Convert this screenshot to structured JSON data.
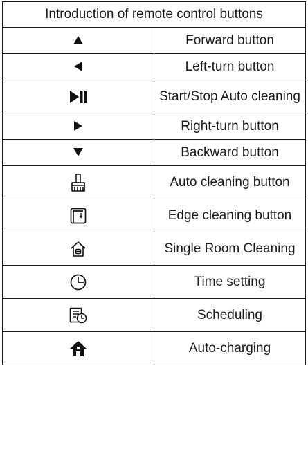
{
  "table": {
    "title": "Introduction of remote control buttons",
    "rows": [
      {
        "icon": "up-triangle-icon",
        "label": "Forward button"
      },
      {
        "icon": "left-triangle-icon",
        "label": "Left-turn button"
      },
      {
        "icon": "play-pause-icon",
        "label": "Start/Stop Auto cleaning"
      },
      {
        "icon": "right-triangle-icon",
        "label": "Right-turn button"
      },
      {
        "icon": "down-triangle-icon",
        "label": "Backward button"
      },
      {
        "icon": "brush-icon",
        "label": "Auto cleaning button"
      },
      {
        "icon": "edge-corner-icon",
        "label": "Edge cleaning button"
      },
      {
        "icon": "room-icon",
        "label": "Single Room Cleaning"
      },
      {
        "icon": "clock-icon",
        "label": "Time setting"
      },
      {
        "icon": "schedule-icon",
        "label": "Scheduling"
      },
      {
        "icon": "home-icon",
        "label": "Auto-charging"
      }
    ]
  }
}
